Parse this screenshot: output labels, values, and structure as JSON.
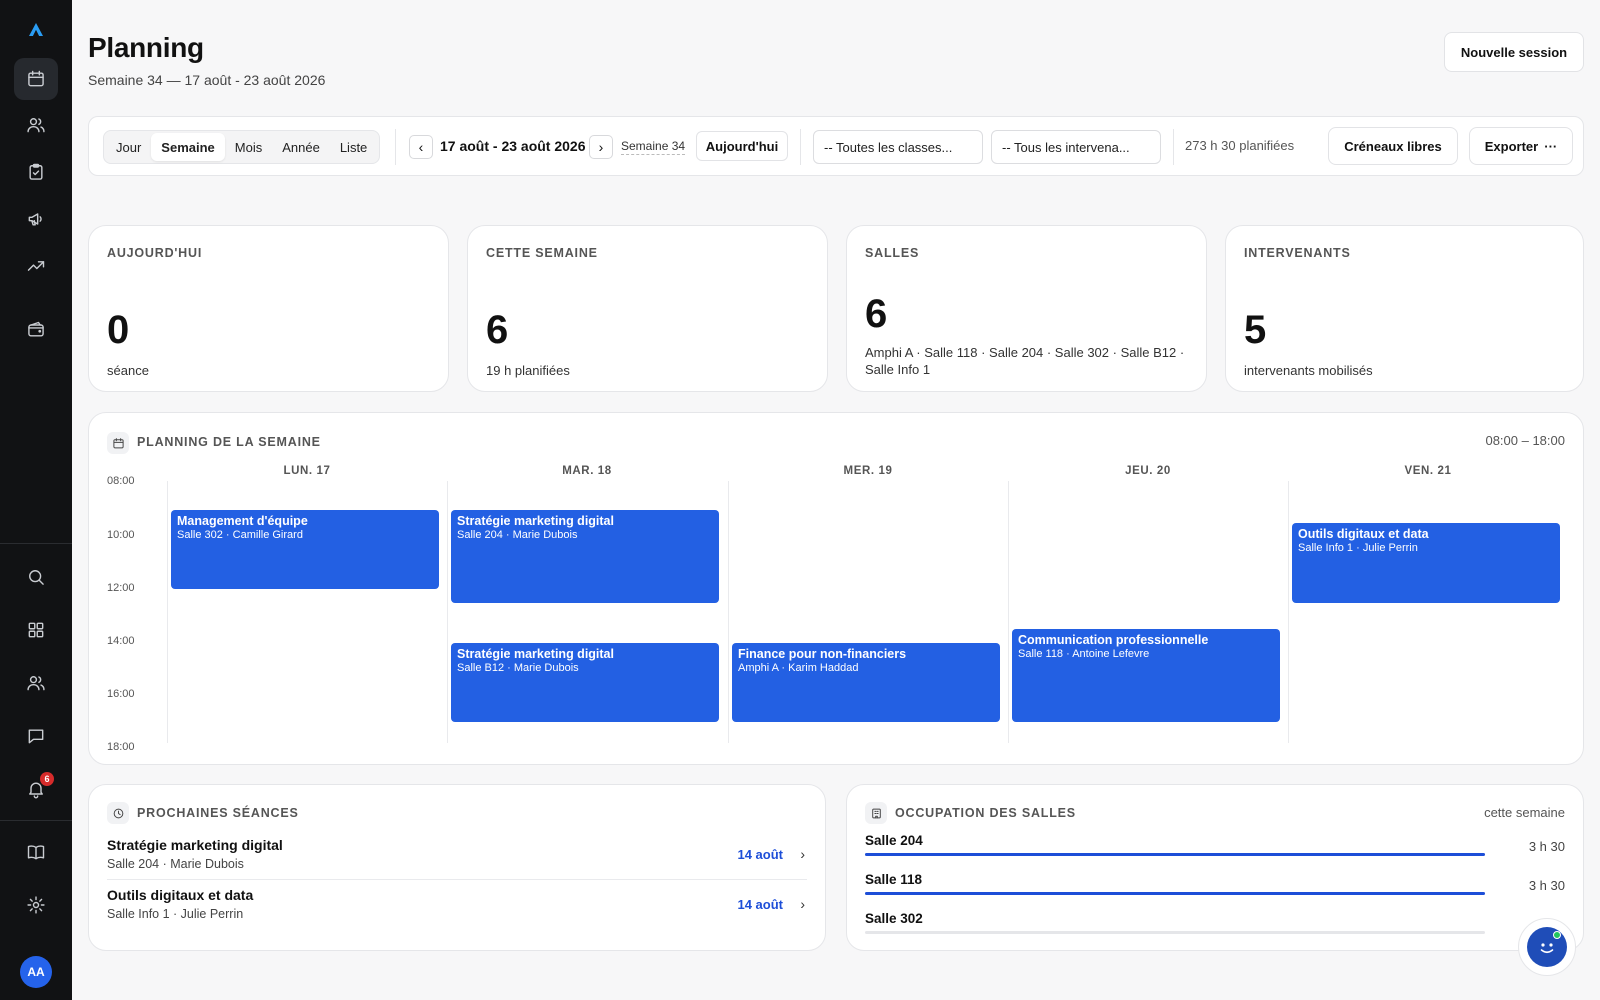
{
  "header": {
    "title": "Planning",
    "subtitle": "Semaine 34 — 17 août - 23 août 2026",
    "new_session": "Nouvelle session"
  },
  "sidebar": {
    "items": [
      {
        "icon": "calendar-icon",
        "active": true
      },
      {
        "icon": "users-icon"
      },
      {
        "icon": "clipboard-check-icon"
      },
      {
        "icon": "megaphone-icon"
      },
      {
        "icon": "trending-up-icon"
      },
      {
        "icon": "wallet-icon"
      },
      {
        "icon": "search-icon"
      },
      {
        "icon": "grid-icon"
      },
      {
        "icon": "users-icon"
      },
      {
        "icon": "message-icon"
      },
      {
        "icon": "bell-icon"
      },
      {
        "icon": "book-icon"
      },
      {
        "icon": "gear-icon"
      }
    ],
    "notification_count": "6",
    "avatar": "AA"
  },
  "toolbar": {
    "views": [
      "Jour",
      "Semaine",
      "Mois",
      "Année",
      "Liste"
    ],
    "active_view": "Semaine",
    "range": "17 août - 23 août 2026",
    "week": "Semaine 34",
    "today": "Aujourd'hui",
    "class_select": "-- Toutes les classes...",
    "speaker_select": "-- Tous les intervena...",
    "planned": "273 h 30 planifiées",
    "free_slots": "Créneaux libres",
    "export": "Exporter",
    "export_icon": "···"
  },
  "stats": [
    {
      "label": "AUJOURD'HUI",
      "value": "0",
      "caption": "séance"
    },
    {
      "label": "CETTE SEMAINE",
      "value": "6",
      "caption": "19 h planifiées"
    },
    {
      "label": "SALLES",
      "value": "6",
      "caption": "Amphi A · Salle 118 · Salle 204 · Salle 302 · Salle B12 · Salle Info 1"
    },
    {
      "label": "INTERVENANTS",
      "value": "5",
      "caption": "intervenants mobilisés"
    }
  ],
  "week_planning": {
    "title": "PLANNING DE LA SEMAINE",
    "range": "08:00 – 18:00",
    "hours": [
      "08:00",
      "10:00",
      "12:00",
      "14:00",
      "16:00",
      "18:00"
    ],
    "days": [
      "LUN. 17",
      "MAR. 18",
      "MER. 19",
      "JEU. 20",
      "VEN. 21"
    ],
    "events": [
      {
        "day": 0,
        "start": 9.0,
        "end": 12.0,
        "title": "Management d'équipe",
        "sub": "Salle 302 · Camille Girard"
      },
      {
        "day": 1,
        "start": 9.0,
        "end": 12.5,
        "title": "Stratégie marketing digital",
        "sub": "Salle 204 · Marie Dubois"
      },
      {
        "day": 1,
        "start": 14.0,
        "end": 17.0,
        "title": "Stratégie marketing digital",
        "sub": "Salle B12 · Marie Dubois"
      },
      {
        "day": 2,
        "start": 14.0,
        "end": 17.0,
        "title": "Finance pour non-financiers",
        "sub": "Amphi A · Karim Haddad"
      },
      {
        "day": 3,
        "start": 13.5,
        "end": 17.0,
        "title": "Communication professionnelle",
        "sub": "Salle 118 · Antoine Lefevre"
      },
      {
        "day": 4,
        "start": 9.5,
        "end": 12.5,
        "title": "Outils digitaux et data",
        "sub": "Salle Info 1 · Julie Perrin"
      }
    ]
  },
  "upcoming": {
    "title": "PROCHAINES SÉANCES",
    "items": [
      {
        "title": "Stratégie marketing digital",
        "sub": "Salle 204 · Marie Dubois",
        "date": "14 août"
      },
      {
        "title": "Outils digitaux et data",
        "sub": "Salle Info 1 · Julie Perrin",
        "date": "14 août"
      }
    ]
  },
  "rooms": {
    "title": "OCCUPATION DES SALLES",
    "meta": "cette semaine",
    "items": [
      {
        "name": "Salle 204",
        "hours": "3 h 30",
        "fill": 1.0
      },
      {
        "name": "Salle 118",
        "hours": "3 h 30",
        "fill": 1.0
      },
      {
        "name": "Salle 302",
        "hours": "",
        "fill": 0.0
      }
    ]
  },
  "colors": {
    "accent": "#2360e3",
    "sidebar": "#111214",
    "badge": "#d62b2b"
  }
}
